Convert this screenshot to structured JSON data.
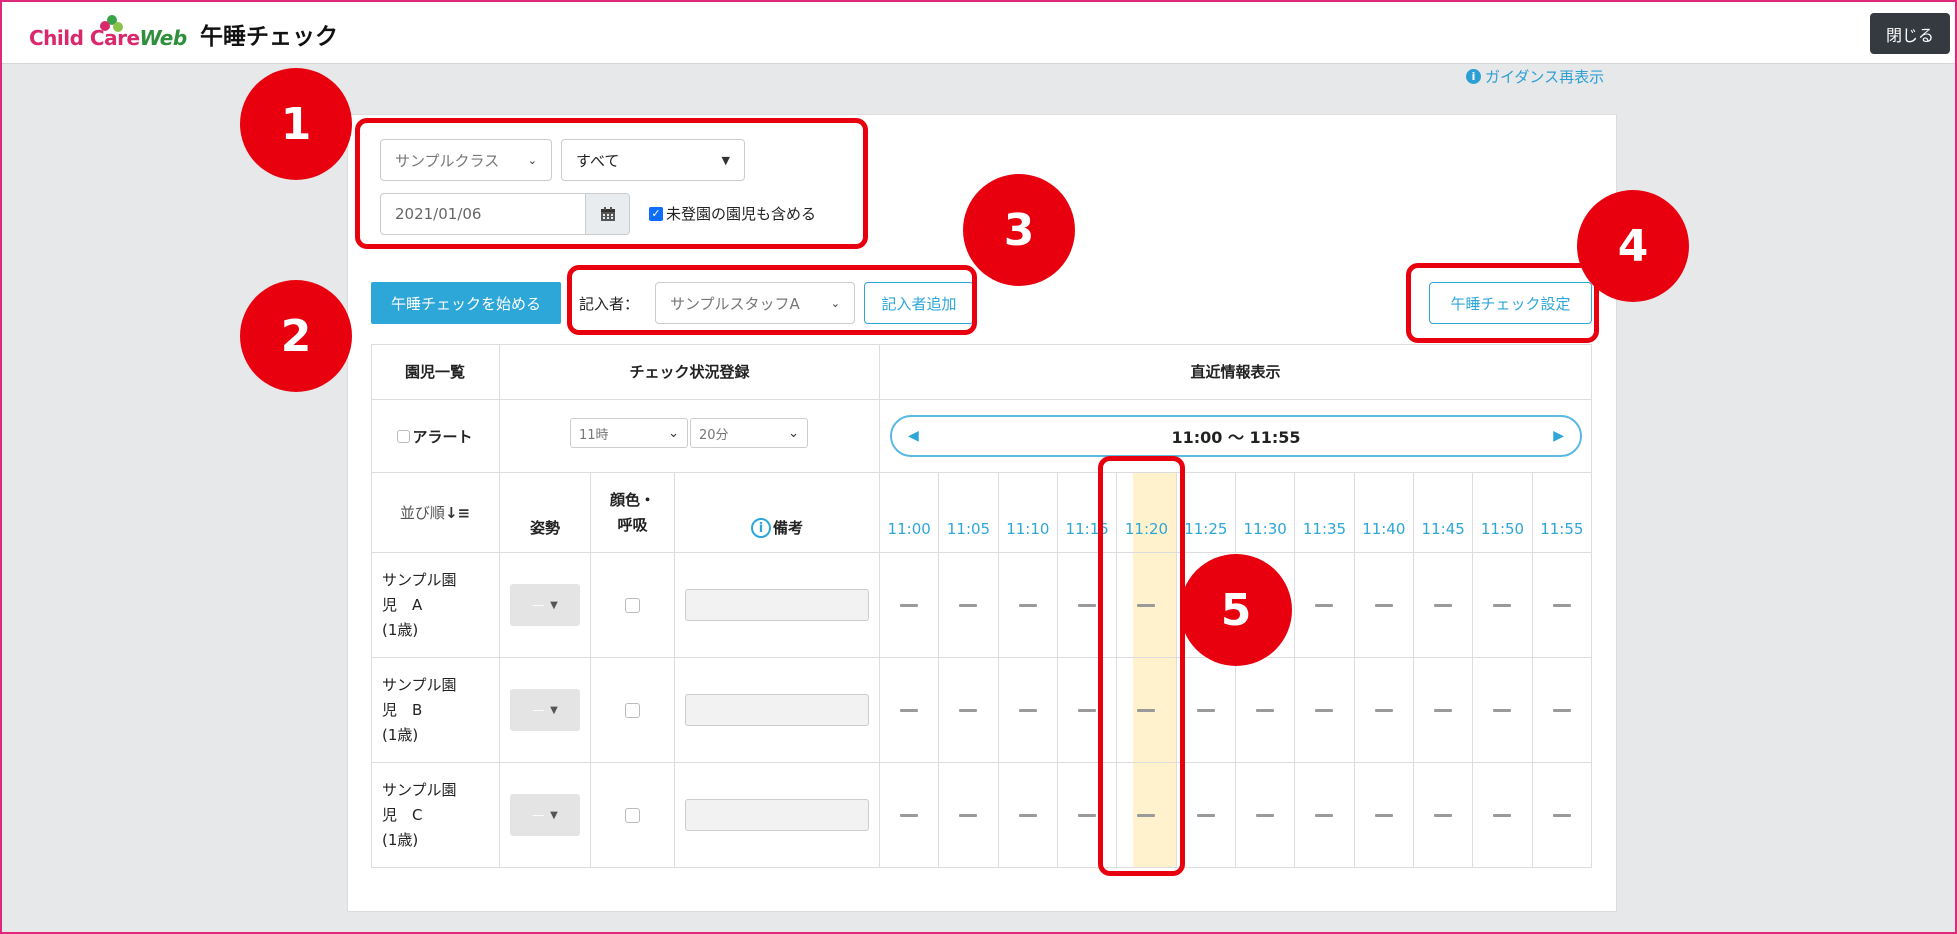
{
  "header": {
    "logo_main": "Child Care",
    "logo_web": "Web",
    "title": "午睡チェック",
    "close_label": "閉じる"
  },
  "guidance_label": "ガイダンス再表示",
  "filters": {
    "class_select": "サンプルクラス",
    "group_select": "すべて",
    "date_value": "2021/01/06",
    "include_unregistered_label": "未登園の園児も含める"
  },
  "actions": {
    "start_label": "午睡チェックを始める",
    "recorder_label": "記入者：",
    "recorder_select": "サンプルスタッフA",
    "add_recorder_label": "記入者追加",
    "settings_label": "午睡チェック設定"
  },
  "table": {
    "headers": {
      "children_list": "園児一覧",
      "status_register": "チェック状況登録",
      "recent_info": "直近情報表示"
    },
    "alert_label": "アラート",
    "hour_select": "11時",
    "minute_select": "20分",
    "range_label": "11:00 〜 11:55",
    "sort_label": "並び順",
    "posture_label": "姿勢",
    "color_breath_label_1": "顔色・",
    "color_breath_label_2": "呼吸",
    "note_label": "備考",
    "times": [
      "11:00",
      "11:05",
      "11:10",
      "11:15",
      "11:20",
      "11:25",
      "11:30",
      "11:35",
      "11:40",
      "11:45",
      "11:50",
      "11:55"
    ],
    "children": [
      {
        "line1": "サンプル園",
        "line2": "児　A",
        "line3": "(1歳)"
      },
      {
        "line1": "サンプル園",
        "line2": "児　B",
        "line3": "(1歳)"
      },
      {
        "line1": "サンプル園",
        "line2": "児　C",
        "line3": "(1歳)"
      }
    ]
  },
  "annotations": [
    "1",
    "2",
    "3",
    "4",
    "5"
  ],
  "colors": {
    "accent": "#2da6d8",
    "annotation": "#e8000f",
    "highlight": "#fff2cc",
    "frame": "#e0287a"
  }
}
